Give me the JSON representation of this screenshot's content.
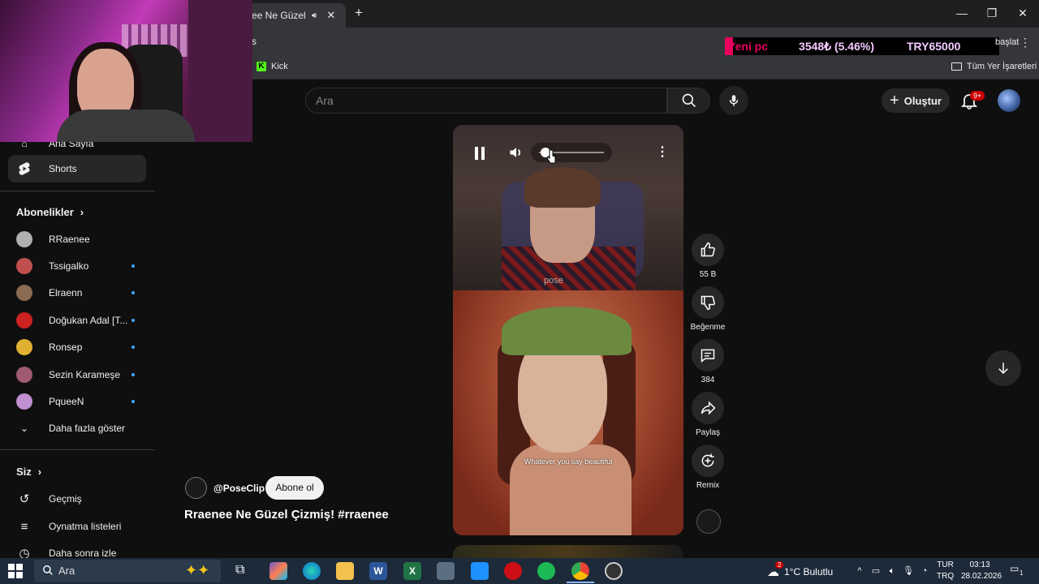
{
  "browser": {
    "tab_title": "ee Ne Güzel Çizmiş",
    "address_fragment": "s",
    "new_tab_icon": "plus-icon",
    "ticker": {
      "label": "Yeni pc",
      "amount": "3548₺ (5.46%)",
      "goal": "TRY65000"
    },
    "start_label": "başlat",
    "bookmarks": [
      {
        "label": "Kick"
      }
    ],
    "all_bookmarks_label": "Tüm Yer İşaretleri"
  },
  "youtube": {
    "search_placeholder": "Ara",
    "create_label": "Oluştur",
    "notification_badge": "9+",
    "accent": "#ff0000"
  },
  "sidebar": {
    "home_label": "Ana Sayfa",
    "shorts_label": "Shorts",
    "subscriptions_header": "Abonelikler",
    "subscriptions": [
      {
        "name": "RRaenee",
        "color": "#b0b0b0",
        "new": false
      },
      {
        "name": "Tssigalko",
        "color": "#c05050",
        "new": true
      },
      {
        "name": "Elraenn",
        "color": "#8a6a50",
        "new": true
      },
      {
        "name": "Doğukan Adal [T...",
        "color": "#cc2222",
        "new": true
      },
      {
        "name": "Ronsep",
        "color": "#e0b030",
        "new": true
      },
      {
        "name": "Sezin Karameşe",
        "color": "#a05a70",
        "new": true
      },
      {
        "name": "PqueeN",
        "color": "#c090d0",
        "new": true
      }
    ],
    "show_more_label": "Daha fazla göster",
    "you_header": "Siz",
    "you_items": [
      {
        "label": "Geçmiş"
      },
      {
        "label": "Oynatma listeleri"
      },
      {
        "label": "Daha sonra izle"
      }
    ]
  },
  "short": {
    "watermark": "pose",
    "subtitle": "Whatever you say beautiful",
    "channel_handle": "@PoseClip",
    "subscribe_label": "Abone ol",
    "title": "Rraenee Ne Güzel Çizmiş! #rraenee",
    "volume_level": 0.05
  },
  "actions": {
    "like_count": "55 B",
    "dislike_label": "Beğenme",
    "comment_count": "384",
    "share_label": "Paylaş",
    "remix_label": "Remix"
  },
  "taskbar": {
    "search_placeholder": "Ara",
    "weather": "1°C Bulutlu",
    "weather_badge": "2",
    "lang_top": "TUR",
    "lang_bottom": "TRQ",
    "time": "03:13",
    "date": "28.02.2026",
    "notif_count": "1"
  }
}
